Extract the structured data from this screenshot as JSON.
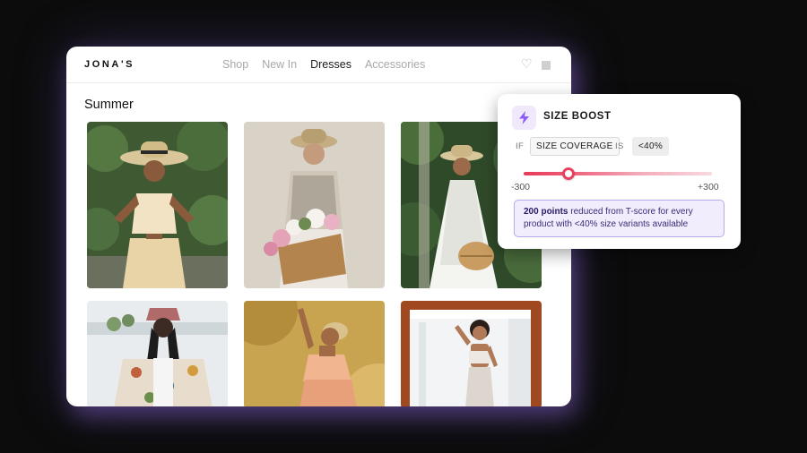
{
  "store": {
    "logo": "JONA'S",
    "nav": [
      "Shop",
      "New In",
      "Dresses",
      "Accessories"
    ],
    "active_nav": "Dresses",
    "section_title": "Summer"
  },
  "rule_card": {
    "title": "SIZE BOOST",
    "if_label": "IF",
    "field": "SIZE COVERAGE",
    "is_label": "IS",
    "value": "<40%",
    "slider": {
      "min_label": "-300",
      "max_label": "+300",
      "min": -300,
      "max": 300,
      "value": -200
    },
    "note_points": "200 points",
    "note_text": " reduced from T-score for every product with <40% size variants available"
  },
  "colors": {
    "accent_purple": "#8b5cf6",
    "slider_pink": "#e8415f",
    "note_bg": "#f1edfd"
  },
  "icons": [
    "heart-icon",
    "bag-icon",
    "lightning-bolt-icon"
  ]
}
